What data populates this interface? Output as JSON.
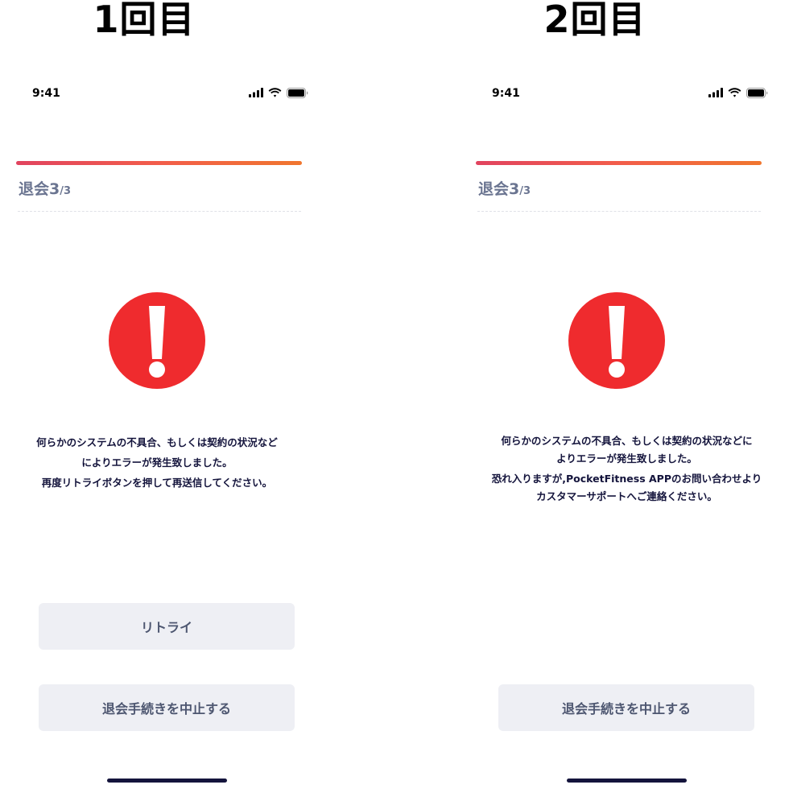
{
  "panels": [
    {
      "heading": "1回目",
      "status": {
        "time": "9:41"
      },
      "progress": 1.0,
      "step": {
        "label": "退会3",
        "total": "/3"
      },
      "message_lines": [
        "何らかのシステムの不具合、もしくは契約の状況など",
        "によりエラーが発生致しました。",
        "再度リトライボタンを押して再送信してください。"
      ],
      "buttons": {
        "retry": "リトライ",
        "cancel": "退会手続きを中止する"
      }
    },
    {
      "heading": "2回目",
      "status": {
        "time": "9:41"
      },
      "progress": 1.0,
      "step": {
        "label": "退会3",
        "total": "/3"
      },
      "message_lines": [
        "何らかのシステムの不具合、もしくは契約の状況などに",
        "よりエラーが発生致しました。",
        "恐れ入りますが,PocketFitness APPのお問い合わせより",
        "カスタマーサポートへご連絡ください。"
      ],
      "buttons": {
        "cancel": "退会手続きを中止する"
      }
    }
  ],
  "colors": {
    "error": "#ef2b2e",
    "progress_start": "#e1435f",
    "progress_end": "#f0762e",
    "button_bg": "#eeeff4",
    "step_text": "#6b7591"
  },
  "icons": [
    "signal-icon",
    "wifi-icon",
    "battery-icon",
    "error-exclamation-icon"
  ]
}
